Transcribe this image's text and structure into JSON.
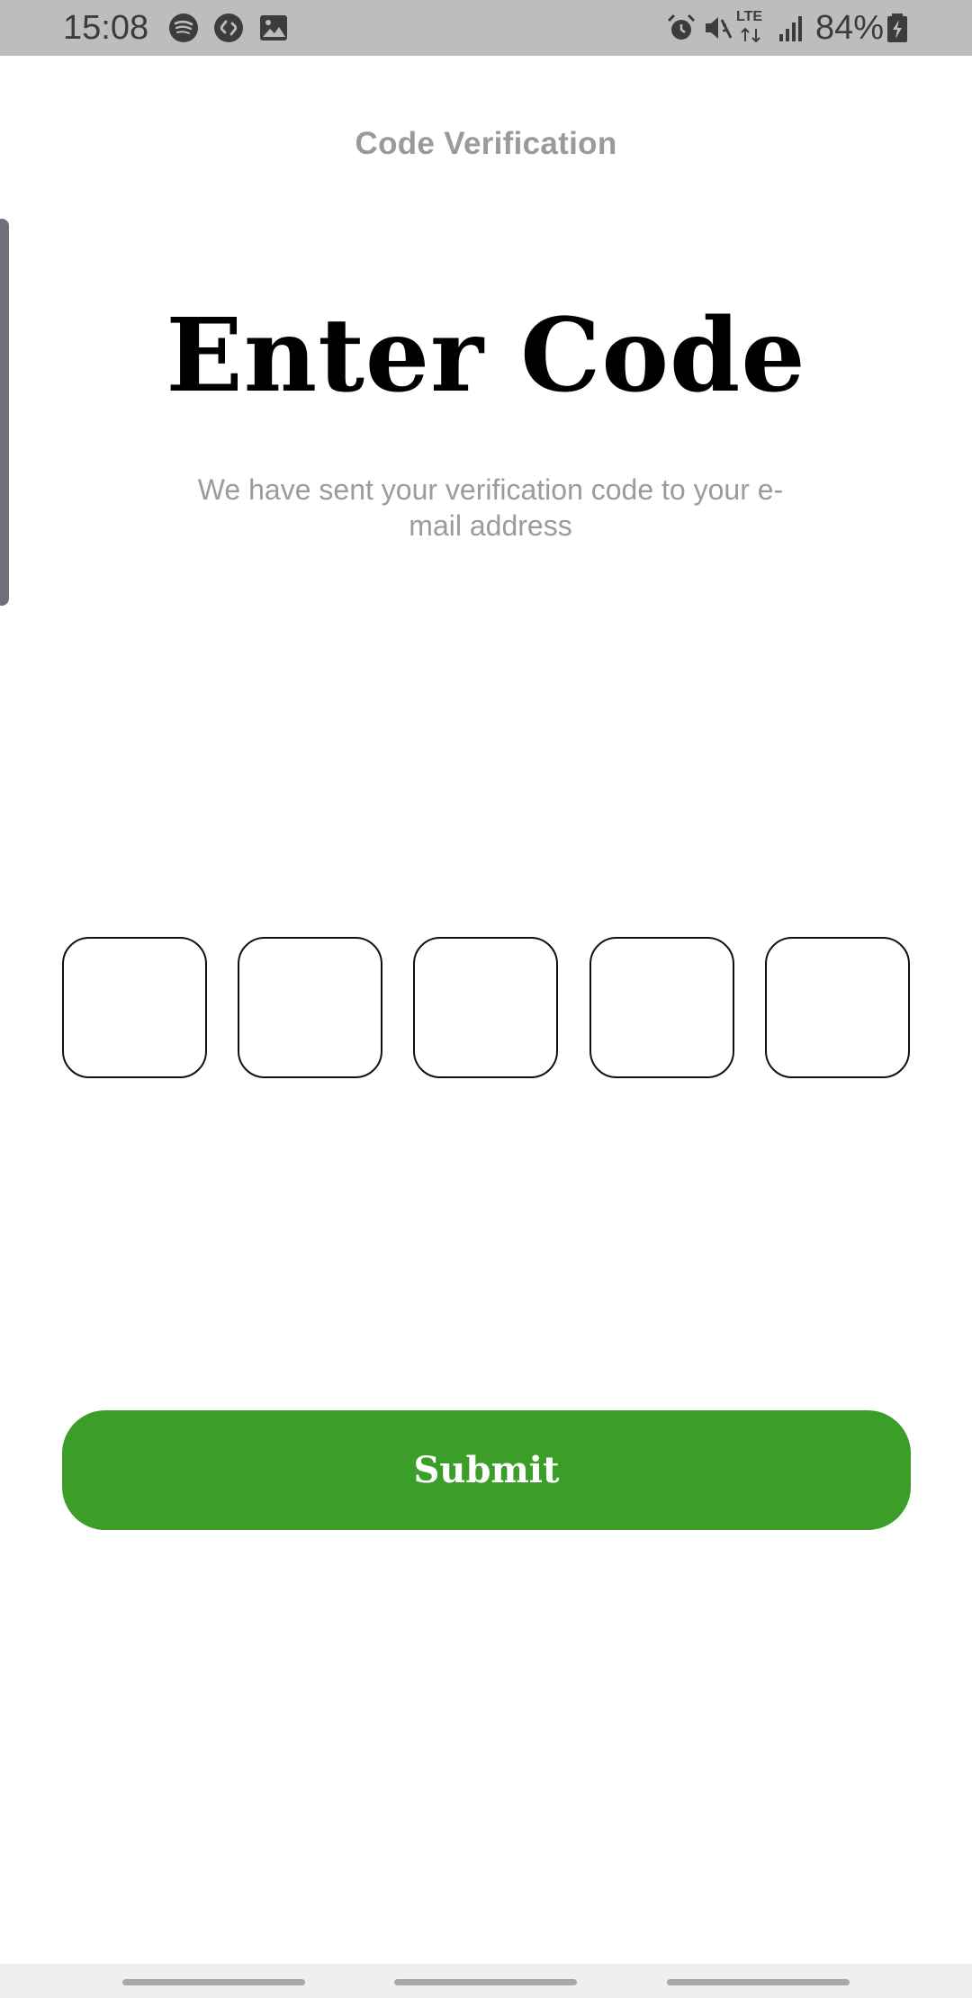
{
  "status_bar": {
    "time": "15:08",
    "lte": "LTE",
    "battery": "84%",
    "icons": [
      "spotify-icon",
      "shazam-icon",
      "gallery-icon",
      "alarm-icon",
      "mute-icon",
      "signal-icon",
      "battery-charging-icon"
    ]
  },
  "header": {
    "title": "Code Verification"
  },
  "main": {
    "heading": "Enter Code",
    "subtitle": "We have sent your verification code to your e-mail address",
    "code_boxes": [
      "",
      "",
      "",
      "",
      ""
    ]
  },
  "actions": {
    "submit_label": "Submit",
    "submit_color": "#3a9e28"
  },
  "nav_bar": {
    "items": [
      "recents-gesture",
      "home-gesture",
      "back-gesture"
    ]
  }
}
